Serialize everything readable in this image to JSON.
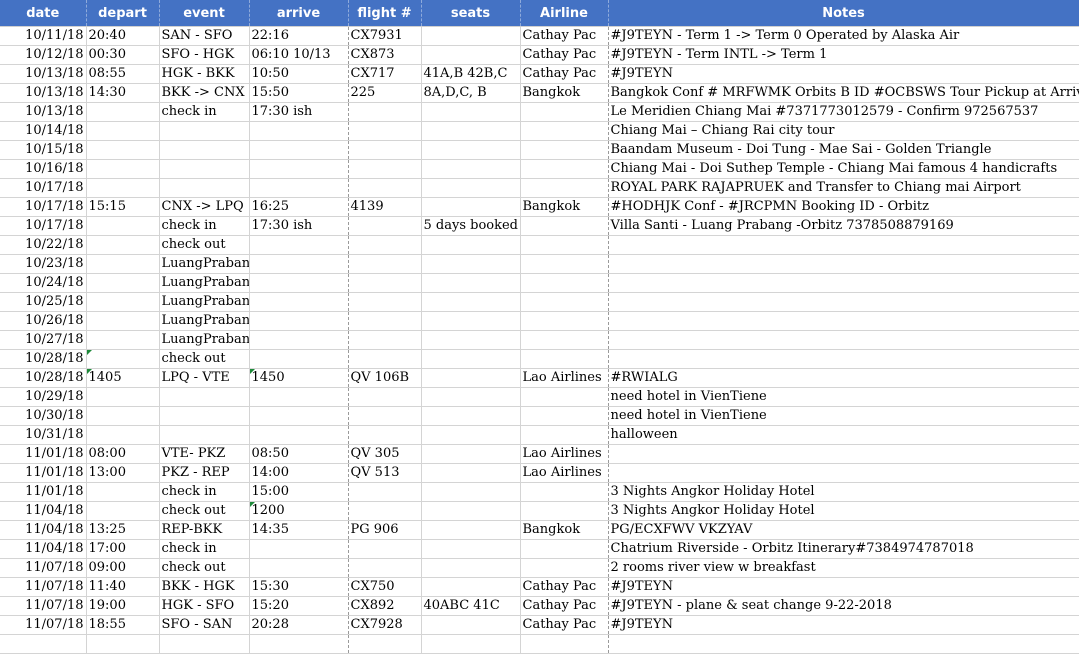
{
  "headers": {
    "date": "date",
    "depart": "depart",
    "event": "event",
    "arrive": "arrive",
    "flight": "flight #",
    "seats": "seats",
    "airline": "Airline",
    "notes": "Notes"
  },
  "rows": [
    {
      "date": "10/11/18",
      "depart": "20:40",
      "event": "SAN - SFO",
      "arrive": "22:16",
      "flight": "CX7931",
      "seats": "",
      "airline": "Cathay Pac",
      "notes": "#J9TEYN - Term 1 -> Term 0 Operated by Alaska Air"
    },
    {
      "date": "10/12/18",
      "depart": "00:30",
      "event": "SFO - HGK",
      "arrive": "06:10 10/13",
      "flight": "CX873",
      "seats": "",
      "airline": "Cathay Pac",
      "notes": "#J9TEYN - Term INTL -> Term 1"
    },
    {
      "date": "10/13/18",
      "depart": "08:55",
      "event": "HGK - BKK",
      "arrive": "10:50",
      "flight": "CX717",
      "seats": "41A,B 42B,C",
      "airline": "Cathay Pac",
      "notes": "#J9TEYN"
    },
    {
      "date": "10/13/18",
      "depart": "14:30",
      "event": "BKK -> CNX",
      "arrive": "15:50",
      "flight": "225",
      "seats": "8A,D,C, B",
      "airline": "Bangkok",
      "notes": "Bangkok Conf # MRFWMK Orbits B ID #OCBSWS Tour Pickup at Arrivals"
    },
    {
      "date": "10/13/18",
      "depart": "",
      "event": "check in",
      "arrive": "17:30 ish",
      "flight": "",
      "seats": "",
      "airline": "",
      "notes": "Le Meridien Chiang Mai #7371773012579 - Confirm 972567537"
    },
    {
      "date": "10/14/18",
      "depart": "",
      "event": "",
      "arrive": "",
      "flight": "",
      "seats": "",
      "airline": "",
      "notes": "Chiang Mai – Chiang Rai  city tour"
    },
    {
      "date": "10/15/18",
      "depart": "",
      "event": "",
      "arrive": "",
      "flight": "",
      "seats": "",
      "airline": "",
      "notes": "Baandam Museum - Doi Tung - Mae Sai - Golden Triangle"
    },
    {
      "date": "10/16/18",
      "depart": "",
      "event": "",
      "arrive": "",
      "flight": "",
      "seats": "",
      "airline": "",
      "notes": "Chiang Mai - Doi Suthep Temple - Chiang Mai famous 4 handicrafts"
    },
    {
      "date": "10/17/18",
      "depart": "",
      "event": "",
      "arrive": "",
      "flight": "",
      "seats": "",
      "airline": "",
      "notes": "ROYAL PARK RAJAPRUEK  and Transfer to Chiang mai Airport"
    },
    {
      "date": "10/17/18",
      "depart": "15:15",
      "event": "CNX -> LPQ",
      "arrive": "16:25",
      "flight": "4139",
      "seats": "",
      "airline": "Bangkok",
      "notes": "#HODHJK Conf - #JRCPMN Booking ID - Orbitz"
    },
    {
      "date": "10/17/18",
      "depart": "",
      "event": "check in",
      "arrive": "17:30 ish",
      "flight": "",
      "seats": "5 days booked",
      "airline": "",
      "notes": "Villa Santi - Luang Prabang -Orbitz 7378508879169"
    },
    {
      "date": "10/22/18",
      "depart": "",
      "event": "check out",
      "arrive": "",
      "flight": "",
      "seats": "",
      "airline": "",
      "notes": ""
    },
    {
      "date": "10/23/18",
      "depart": "",
      "event": "LuangPrabang",
      "arrive": "",
      "flight": "",
      "seats": "",
      "airline": "",
      "notes": ""
    },
    {
      "date": "10/24/18",
      "depart": "",
      "event": "LuangPrabang",
      "arrive": "",
      "flight": "",
      "seats": "",
      "airline": "",
      "notes": ""
    },
    {
      "date": "10/25/18",
      "depart": "",
      "event": "LuangPrabang",
      "arrive": "",
      "flight": "",
      "seats": "",
      "airline": "",
      "notes": ""
    },
    {
      "date": "10/26/18",
      "depart": "",
      "event": "LuangPrabang",
      "arrive": "",
      "flight": "",
      "seats": "",
      "airline": "",
      "notes": ""
    },
    {
      "date": "10/27/18",
      "depart": "",
      "event": "LuangPrabang",
      "arrive": "",
      "flight": "",
      "seats": "",
      "airline": "",
      "notes": ""
    },
    {
      "date": "10/28/18",
      "depart": "",
      "event": "check out",
      "arrive": "",
      "flight": "",
      "seats": "",
      "airline": "",
      "notes": ""
    },
    {
      "date": "10/28/18",
      "depart": "1405",
      "event": "LPQ - VTE",
      "arrive": "1450",
      "flight": "QV 106B",
      "seats": "",
      "airline": "Lao Airlines",
      "notes": "#RWIALG"
    },
    {
      "date": "10/29/18",
      "depart": "",
      "event": "",
      "arrive": "",
      "flight": "",
      "seats": "",
      "airline": "",
      "notes": "need hotel in VienTiene"
    },
    {
      "date": "10/30/18",
      "depart": "",
      "event": "",
      "arrive": "",
      "flight": "",
      "seats": "",
      "airline": "",
      "notes": "need hotel in VienTiene"
    },
    {
      "date": "10/31/18",
      "depart": "",
      "event": "",
      "arrive": "",
      "flight": "",
      "seats": "",
      "airline": "",
      "notes": "halloween"
    },
    {
      "date": "11/01/18",
      "depart": "08:00",
      "event": "VTE- PKZ",
      "arrive": "08:50",
      "flight": "QV 305",
      "seats": "",
      "airline": "Lao Airlines",
      "notes": ""
    },
    {
      "date": "11/01/18",
      "depart": "13:00",
      "event": "PKZ - REP",
      "arrive": "14:00",
      "flight": "QV 513",
      "seats": "",
      "airline": "Lao Airlines",
      "notes": ""
    },
    {
      "date": "11/01/18",
      "depart": "",
      "event": "check in",
      "arrive": "15:00",
      "flight": "",
      "seats": "",
      "airline": "",
      "notes": "3 Nights Angkor Holiday Hotel"
    },
    {
      "date": "11/04/18",
      "depart": "",
      "event": "check out",
      "arrive": "1200",
      "flight": "",
      "seats": "",
      "airline": "",
      "notes": "3 Nights Angkor Holiday Hotel"
    },
    {
      "date": "11/04/18",
      "depart": "13:25",
      "event": "REP-BKK",
      "arrive": "14:35",
      "flight": "PG 906",
      "seats": "",
      "airline": "Bangkok",
      "notes": "PG/ECXFWV VKZYAV"
    },
    {
      "date": "11/04/18",
      "depart": "17:00",
      "event": "check in",
      "arrive": "",
      "flight": "",
      "seats": "",
      "airline": "",
      "notes": "Chatrium Riverside - Orbitz Itinerary#7384974787018"
    },
    {
      "date": "11/07/18",
      "depart": "09:00",
      "event": "check out",
      "arrive": "",
      "flight": "",
      "seats": "",
      "airline": "",
      "notes": "2 rooms river view w breakfast"
    },
    {
      "date": "11/07/18",
      "depart": "11:40",
      "event": "BKK - HGK",
      "arrive": "15:30",
      "flight": "CX750",
      "seats": "",
      "airline": "Cathay Pac",
      "notes": "#J9TEYN"
    },
    {
      "date": "11/07/18",
      "depart": "19:00",
      "event": "HGK - SFO",
      "arrive": "15:20",
      "flight": "CX892",
      "seats": "40ABC 41C",
      "airline": "Cathay Pac",
      "notes": "#J9TEYN - plane & seat change 9-22-2018"
    },
    {
      "date": "11/07/18",
      "depart": "18:55",
      "event": "SFO - SAN",
      "arrive": "20:28",
      "flight": "CX7928",
      "seats": "",
      "airline": "Cathay Pac",
      "notes": "#J9TEYN"
    },
    {
      "date": "",
      "depart": "",
      "event": "",
      "arrive": "",
      "flight": "",
      "seats": "",
      "airline": "",
      "notes": ""
    }
  ]
}
